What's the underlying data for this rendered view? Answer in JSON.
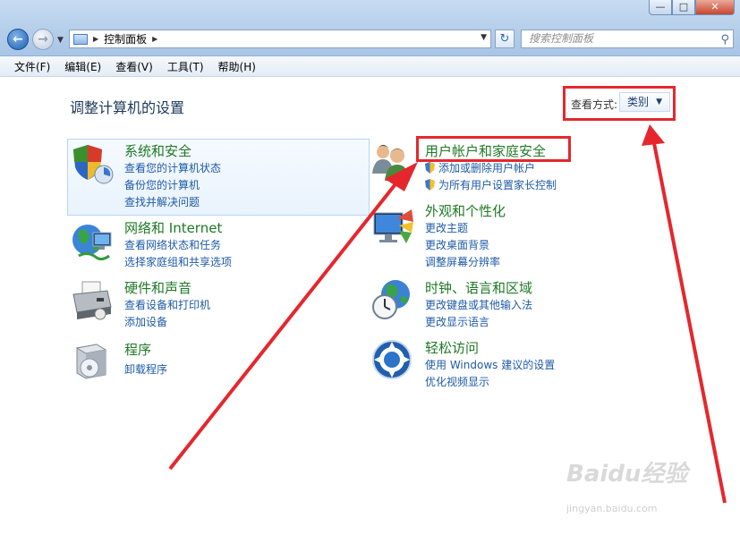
{
  "window": {
    "controls": {
      "minimize": "—",
      "maximize": "□",
      "close": "✕"
    }
  },
  "address": {
    "breadcrumb": "控制面板",
    "search_placeholder": "搜索控制面板"
  },
  "menu": [
    "文件(F)",
    "编辑(E)",
    "查看(V)",
    "工具(T)",
    "帮助(H)"
  ],
  "page": {
    "title": "调整计算机的设置",
    "view_label": "查看方式:",
    "view_value": "类别"
  },
  "categories": {
    "security": {
      "title": "系统和安全",
      "links": [
        "查看您的计算机状态",
        "备份您的计算机",
        "查找并解决问题"
      ]
    },
    "network": {
      "title": "网络和 Internet",
      "links": [
        "查看网络状态和任务",
        "选择家庭组和共享选项"
      ]
    },
    "hardware": {
      "title": "硬件和声音",
      "links": [
        "查看设备和打印机",
        "添加设备"
      ]
    },
    "programs": {
      "title": "程序",
      "links": [
        "卸载程序"
      ]
    },
    "users": {
      "title": "用户帐户和家庭安全",
      "links": [
        "添加或删除用户帐户",
        "为所有用户设置家长控制"
      ]
    },
    "appearance": {
      "title": "外观和个性化",
      "links": [
        "更改主题",
        "更改桌面背景",
        "调整屏幕分辨率"
      ]
    },
    "clock": {
      "title": "时钟、语言和区域",
      "links": [
        "更改键盘或其他输入法",
        "更改显示语言"
      ]
    },
    "ease": {
      "title": "轻松访问",
      "links": [
        "使用 Windows 建议的设置",
        "优化视频显示"
      ]
    }
  },
  "watermark": {
    "main": "Baidu经验",
    "sub": "jingyan.baidu.com"
  },
  "colors": {
    "highlight": "#e5272d",
    "category_title": "#1f7a25",
    "link": "#1e5aa8"
  }
}
